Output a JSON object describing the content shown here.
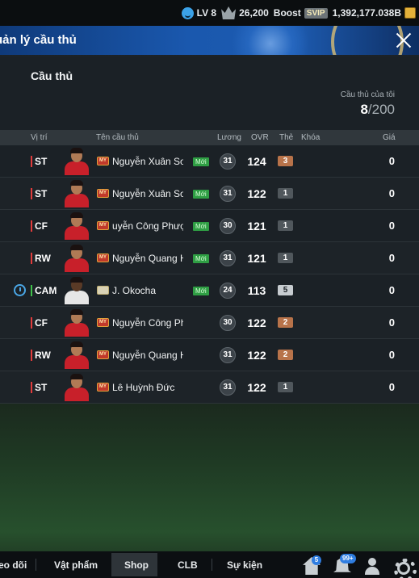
{
  "status_bar": {
    "level": "LV 8",
    "crowns": "26,200",
    "boost_label": "Boost",
    "vip_label": "SVIP",
    "currency": "1,392,177.038B"
  },
  "header": {
    "title": "uản lý cầu thủ"
  },
  "section": {
    "title": "Cầu thủ",
    "count_label": "Cầu thủ của tôi",
    "count_current": "8",
    "count_total": "/200"
  },
  "columns": {
    "position": "Vị trí",
    "name": "Tên cầu thủ",
    "pay": "Lương",
    "ovr": "OVR",
    "grade": "Thẻ",
    "lock": "Khóa",
    "price": "Giá"
  },
  "season_tag": "MY",
  "new_badge": "Mới",
  "players": [
    {
      "position": "ST",
      "name": "Nguyễn Xuân Son",
      "is_new": true,
      "pay": "31",
      "ovr": "124",
      "grade": "3",
      "grade_color": "#b8734a",
      "price": "0"
    },
    {
      "position": "ST",
      "name": "Nguyễn Xuân Son",
      "is_new": true,
      "pay": "31",
      "ovr": "122",
      "grade": "1",
      "grade_color": "#50575c",
      "price": "0"
    },
    {
      "position": "CF",
      "name": "uyễn Công Phượng",
      "is_new": true,
      "pay": "30",
      "ovr": "121",
      "grade": "1",
      "grade_color": "#50575c",
      "price": "0"
    },
    {
      "position": "RW",
      "name": "Nguyễn Quang Hải",
      "is_new": true,
      "pay": "31",
      "ovr": "121",
      "grade": "1",
      "grade_color": "#50575c",
      "price": "0"
    },
    {
      "position": "CAM",
      "name": "J. Okocha",
      "is_new": true,
      "pay": "24",
      "ovr": "113",
      "grade": "5",
      "grade_color": "#c7ccd0",
      "price": "0"
    },
    {
      "position": "CF",
      "name": "Nguyễn Công Phượng",
      "is_new": false,
      "pay": "30",
      "ovr": "122",
      "grade": "2",
      "grade_color": "#b8734a",
      "price": "0"
    },
    {
      "position": "RW",
      "name": "Nguyễn Quang Hải",
      "is_new": false,
      "pay": "31",
      "ovr": "122",
      "grade": "2",
      "grade_color": "#b8734a",
      "price": "0"
    },
    {
      "position": "ST",
      "name": "Lê Huỳnh Đức",
      "is_new": false,
      "pay": "31",
      "ovr": "122",
      "grade": "1",
      "grade_color": "#50575c",
      "price": "0"
    }
  ],
  "bottom_nav": {
    "follow": "eo dõi",
    "items": "Vật phẩm",
    "shop": "Shop",
    "club": "CLB",
    "events": "Sự kiện",
    "home_badge": "5",
    "notif_badge": "99+"
  }
}
